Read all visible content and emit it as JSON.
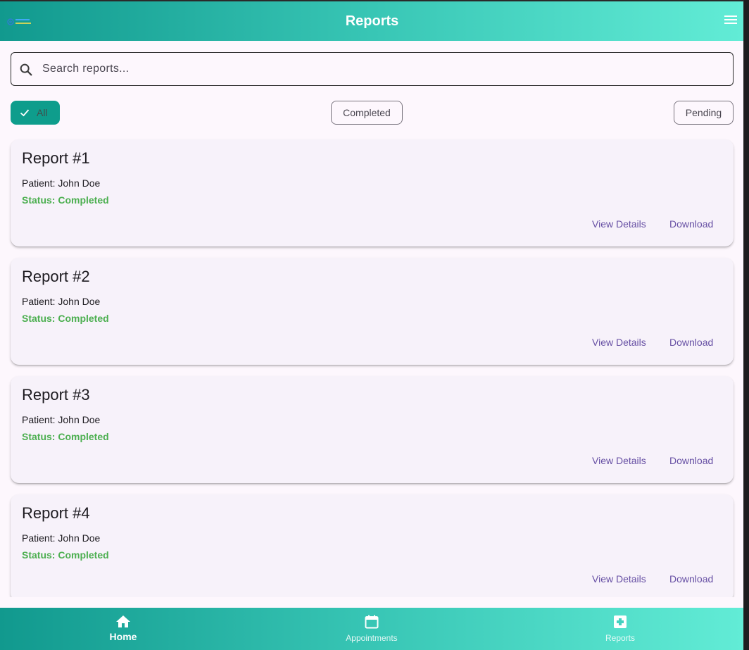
{
  "app": {
    "title": "Reports",
    "logo_icon": "app-logo",
    "menu_icon": "hamburger-menu-icon"
  },
  "search": {
    "placeholder": "Search reports...",
    "value": "",
    "icon": "search-icon"
  },
  "filters": {
    "all": "All",
    "completed": "Completed",
    "pending": "Pending",
    "selected": "All"
  },
  "reports": [
    {
      "title": "Report #1",
      "patient": "Patient: John Doe",
      "status": "Status: Completed",
      "view_label": "View Details",
      "download_label": "Download"
    },
    {
      "title": "Report #2",
      "patient": "Patient: John Doe",
      "status": "Status: Completed",
      "view_label": "View Details",
      "download_label": "Download"
    },
    {
      "title": "Report #3",
      "patient": "Patient: John Doe",
      "status": "Status: Completed",
      "view_label": "View Details",
      "download_label": "Download"
    },
    {
      "title": "Report #4",
      "patient": "Patient: John Doe",
      "status": "Status: Completed",
      "view_label": "View Details",
      "download_label": "Download"
    }
  ],
  "bottom_nav": {
    "home": "Home",
    "appointments": "Appointments",
    "reports": "Reports"
  },
  "colors": {
    "header_gradient_start": "#11998e",
    "header_gradient_end": "#62ecd6",
    "chip_selected": "#0e9d8c",
    "status_completed": "#4caf50",
    "action_text": "#6750a4",
    "background": "#fdf7fd",
    "card": "#f7f2fa"
  }
}
